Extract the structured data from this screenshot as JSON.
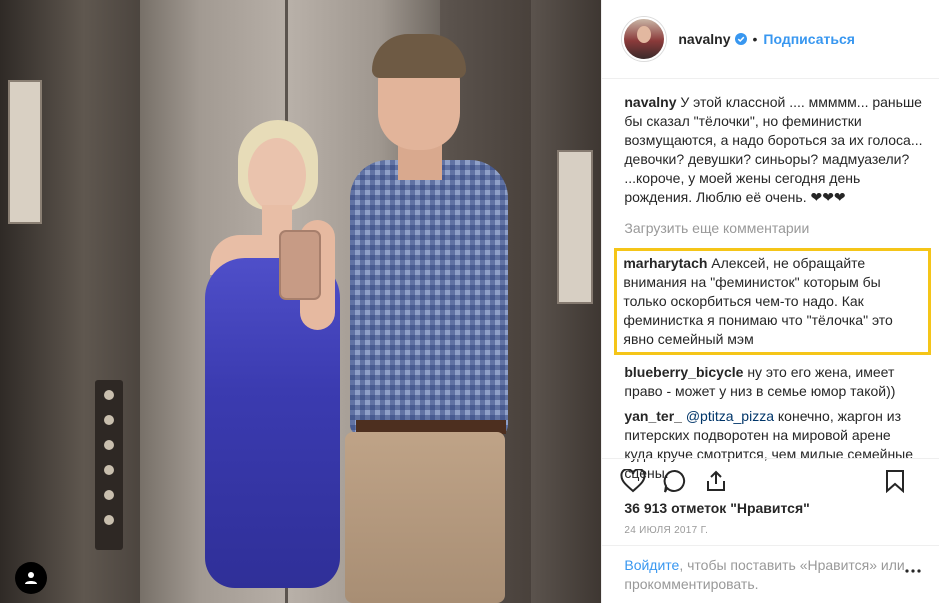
{
  "post": {
    "photo_alt": "",
    "colors": {
      "link": "#3897f0",
      "highlight": "#f5c518",
      "heart": "#ed4956"
    }
  },
  "header": {
    "username": "navalny",
    "separator": "•",
    "follow_label": "Подписаться"
  },
  "caption": {
    "username": "navalny",
    "text": "У этой классной .... ммммм... раньше бы сказал \"тёлочки\", но феминистки возмущаются, а надо бороться за их голоса... девочки? девушки? синьоры? мадмуазели? ...короче, у моей жены сегодня день рождения. Люблю её очень. ❤❤❤"
  },
  "load_more": "Загрузить еще комментарии",
  "comments": [
    {
      "username": "marharytach",
      "text": "Алексей, не обращайте внимания на \"феминисток\" которым бы только оскорбиться чем-то надо. Как феминистка я понимаю что \"тёлочка\" это явно семейный мэм",
      "highlighted": true
    },
    {
      "username": "blueberry_bicycle",
      "text": "ну это его жена, имеет право - может у низ в семье юмор такой))",
      "highlighted": false
    },
    {
      "username": "yan_ter_",
      "mention": "@ptitza_pizza",
      "text": "конечно, жаргон из питерских подворотен на мировой арене куда круче смотрится, чем милые семейные сцены.",
      "highlighted": false
    }
  ],
  "likes": "36 913 отметок \"Нравится\"",
  "date": "24 ИЮЛЯ 2017 Г.",
  "login": {
    "link": "Войдите",
    "text": ", чтобы поставить «Нравится» или прокомментировать."
  },
  "icons": [
    "heart-icon",
    "comment-icon",
    "share-icon",
    "bookmark-icon",
    "more-icon",
    "user-icon",
    "verified-icon"
  ]
}
